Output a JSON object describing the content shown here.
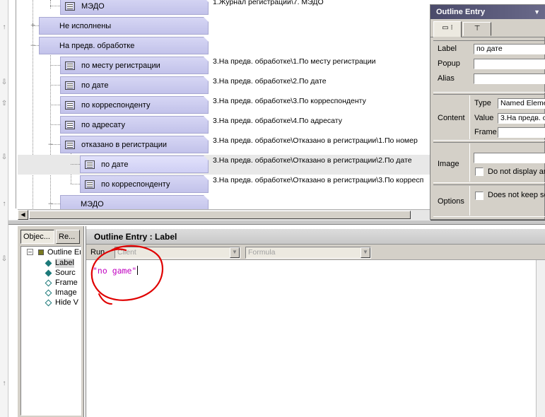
{
  "outline": {
    "rows": [
      {
        "label": "МЭДО",
        "path": "1.Журнал регистрации\\7. МЭДО",
        "level": 2,
        "icon": true,
        "expander": ""
      },
      {
        "label": "Не исполнены",
        "path": "",
        "level": 1,
        "icon": false,
        "expander": "+"
      },
      {
        "label": "На предв. обработке",
        "path": "",
        "level": 1,
        "icon": false,
        "expander": "–"
      },
      {
        "label": "по месту регистрации",
        "path": "3.На предв. обработке\\1.По месту регистрации",
        "level": 2,
        "icon": true,
        "expander": ""
      },
      {
        "label": "по дате",
        "path": "3.На предв. обработке\\2.По дате",
        "level": 2,
        "icon": true,
        "expander": ""
      },
      {
        "label": "по корреспонденту",
        "path": "3.На предв. обработке\\3.По корреспонденту",
        "level": 2,
        "icon": true,
        "expander": ""
      },
      {
        "label": "по адресату",
        "path": "3.На предв. обработке\\4.По адресату",
        "level": 2,
        "icon": true,
        "expander": ""
      },
      {
        "label": "отказано в регистрации",
        "path": "3.На предв. обработке\\Отказано в регистрации\\1.По номер",
        "level": 2,
        "icon": true,
        "expander": "–"
      },
      {
        "label": "по дате",
        "path": "3.На предв. обработке\\Отказано в регистрации\\2.По дате",
        "level": 3,
        "icon": true,
        "expander": "",
        "selected": true
      },
      {
        "label": "по корреспонденту",
        "path": "3.На предв. обработке\\Отказано в регистрации\\3.По корресп",
        "level": 3,
        "icon": true,
        "expander": ""
      },
      {
        "label": "МЭДО",
        "path": "",
        "level": 2,
        "icon": false,
        "expander": "–"
      }
    ]
  },
  "props": {
    "title": "Outline Entry",
    "dropdown_glyph": "▼",
    "tab1_glyph": "▭ ⁝",
    "tab2_glyph": "⊤",
    "label_caption": "Label",
    "label_value": "по дате",
    "popup_caption": "Popup",
    "popup_value": "",
    "alias_caption": "Alias",
    "alias_value": "",
    "content_caption": "Content",
    "type_caption": "Type",
    "type_value": "Named Eleme",
    "value_caption": "Value",
    "value_value": "3.На предв. о",
    "frame_caption": "Frame",
    "frame_value": "",
    "image_caption": "Image",
    "image_value": "",
    "image_check_label": "Do not display an",
    "options_caption": "Options",
    "options_check_label": "Does not keep se"
  },
  "nav": {
    "tabs": [
      "Objec...",
      "Re..."
    ],
    "tree": {
      "root": "Outline En",
      "children": [
        "Label",
        "Sourc",
        "Frame",
        "Image",
        "Hide V"
      ]
    }
  },
  "editor": {
    "title": "Outline Entry : Label",
    "run_label": "Run",
    "client_value": "Client",
    "formula_value": "Formula",
    "code": "\"no game\""
  },
  "colors": {
    "entry_fill": "#c8c8ee",
    "code_string": "#c000c0",
    "annotation": "#e00000"
  }
}
